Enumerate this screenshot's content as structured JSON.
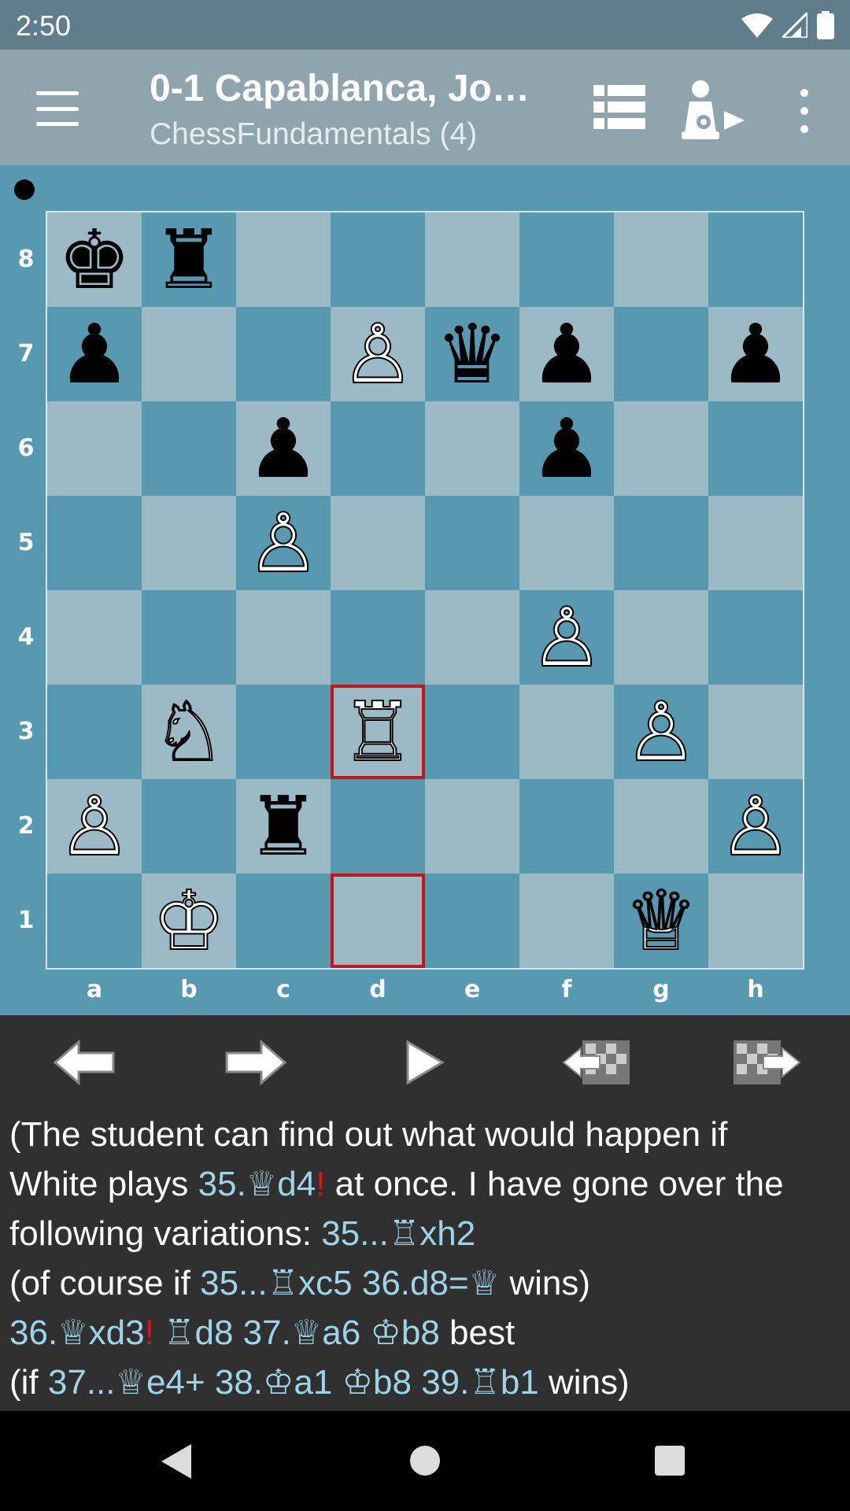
{
  "status": {
    "time": "2:50"
  },
  "toolbar": {
    "title": "0-1 Capablanca, Jo…",
    "subtitle": "ChessFundamentals (4)"
  },
  "board": {
    "ranks": [
      "8",
      "7",
      "6",
      "5",
      "4",
      "3",
      "2",
      "1"
    ],
    "files": [
      "a",
      "b",
      "c",
      "d",
      "e",
      "f",
      "g",
      "h"
    ],
    "pieces": {
      "a8": "♚",
      "b8": "♜",
      "a7": "♟",
      "d7": "♙",
      "e7": "♛",
      "f7": "♟",
      "h7": "♟",
      "c6": "♟",
      "f6": "♟",
      "c5": "♙",
      "f4": "♙",
      "b3": "♘",
      "d3": "♖",
      "g3": "♙",
      "a2": "♙",
      "c2": "♜",
      "h2": "♙",
      "b1": "♔",
      "g1": "♕"
    },
    "white_pieces": [
      "d7",
      "c5",
      "f4",
      "b3",
      "d3",
      "g3",
      "a2",
      "h2",
      "b1",
      "g1"
    ],
    "highlight": [
      "d3",
      "d1"
    ],
    "colors": {
      "light": "#9bbac6",
      "dark": "#5699b1",
      "highlight": "#c8151b"
    }
  },
  "comment": {
    "l1_t1": "(The student can find out what would happen if",
    "l2_t1": "White plays ",
    "l2_m1": "35.♕d4",
    "l2_r1": "!",
    "l2_t2": " at once. I have gone over the",
    "l3_t1": "following variations: ",
    "l3_m1": "35...♖xh2",
    "l4_t1": " (of course if ",
    "l4_m1": "35...♖xc5 36.d8=♕",
    "l4_t2": " wins)",
    "l5_m1": "36.♕xd3",
    "l5_r1": "!",
    "l5_m2": " ♖d8 37.♕a6 ♔b8",
    "l5_t1": " best",
    "l6_t1": " (if ",
    "l6_m1": "37...♕e4+ 38.♔a1 ♔b8 39.♖b1",
    "l6_t2": " wins)"
  }
}
